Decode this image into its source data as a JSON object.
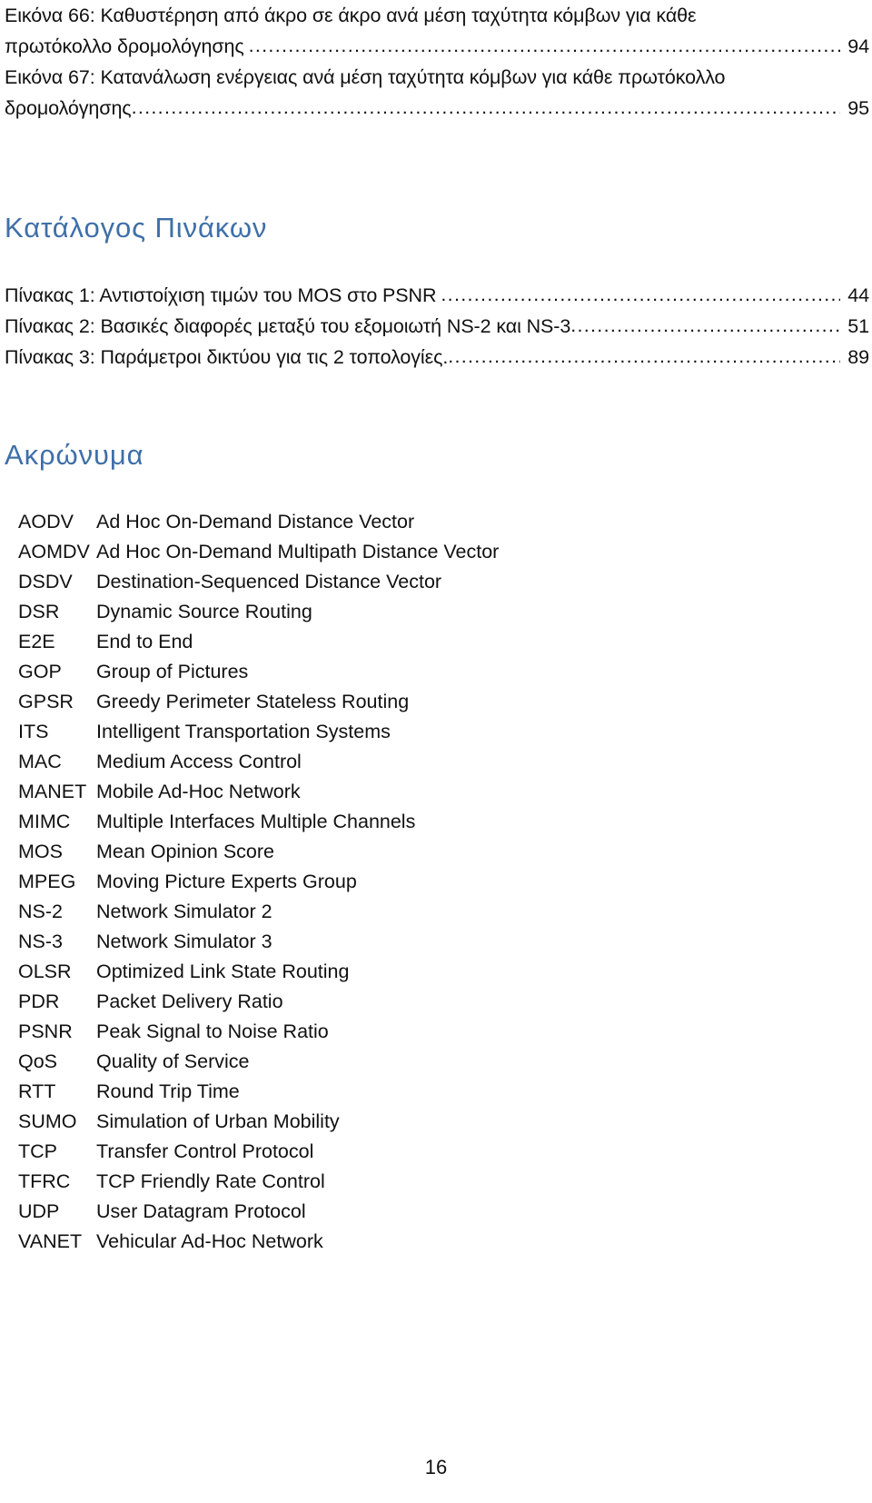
{
  "document": {
    "page_number": "16"
  },
  "figures_toc": {
    "entries": [
      {
        "line1": "Εικόνα 66: Καθυστέρηση από άκρο σε άκρο ανά μέση ταχύτητα κόμβων για κάθε",
        "line2": "πρωτόκολλο δρομολόγησης",
        "page": "94"
      },
      {
        "line1": "Εικόνα 67: Κατανάλωση ενέργειας ανά μέση ταχύτητα κόμβων για κάθε πρωτόκολλο",
        "line2": "δρομολόγησης",
        "page": "95"
      }
    ]
  },
  "tables_toc": {
    "heading": "Κατάλογος Πινάκων",
    "entries": [
      {
        "text": "Πίνακας 1: Αντιστοίχιση τιμών του MOS στο PSNR",
        "page": "44"
      },
      {
        "text": "Πίνακας 2: Βασικές διαφορές μεταξύ του εξομοιωτή NS-2 και NS-3",
        "page": "51"
      },
      {
        "text": "Πίνακας 3: Παράμετροι δικτύου για τις 2 τοπολογίες.",
        "page": "89"
      }
    ]
  },
  "acronyms": {
    "heading": "Ακρώνυμα",
    "items": [
      {
        "abbr": "AODV",
        "meaning": "Ad Hoc On-Demand Distance Vector"
      },
      {
        "abbr": "AOMDV",
        "meaning": "Ad Hoc On-Demand Multipath Distance Vector"
      },
      {
        "abbr": "DSDV",
        "meaning": "Destination-Sequenced Distance Vector"
      },
      {
        "abbr": "DSR",
        "meaning": "Dynamic Source Routing"
      },
      {
        "abbr": "E2E",
        "meaning": "End to End"
      },
      {
        "abbr": "GOP",
        "meaning": "Group of Pictures"
      },
      {
        "abbr": "GPSR",
        "meaning": "Greedy Perimeter Stateless Routing"
      },
      {
        "abbr": "ITS",
        "meaning": "Intelligent Transportation Systems"
      },
      {
        "abbr": "MAC",
        "meaning": "Medium Access Control"
      },
      {
        "abbr": "MANET",
        "meaning": "Mobile Ad-Hoc Network"
      },
      {
        "abbr": "MIMC",
        "meaning": "Multiple Interfaces Multiple Channels"
      },
      {
        "abbr": "MOS",
        "meaning": "Mean Opinion Score"
      },
      {
        "abbr": "MPEG",
        "meaning": "Moving Picture Experts Group"
      },
      {
        "abbr": "NS-2",
        "meaning": "Network Simulator 2"
      },
      {
        "abbr": "NS-3",
        "meaning": "Network Simulator 3"
      },
      {
        "abbr": "OLSR",
        "meaning": "Optimized Link State Routing"
      },
      {
        "abbr": "PDR",
        "meaning": "Packet Delivery Ratio"
      },
      {
        "abbr": "PSNR",
        "meaning": "Peak Signal to Noise Ratio"
      },
      {
        "abbr": "QoS",
        "meaning": "Quality of Service"
      },
      {
        "abbr": "RTT",
        "meaning": "Round Trip Time"
      },
      {
        "abbr": "SUMO",
        "meaning": "Simulation of Urban Mobility"
      },
      {
        "abbr": "TCP",
        "meaning": "Transfer Control Protocol"
      },
      {
        "abbr": "TFRC",
        "meaning": "TCP Friendly Rate Control"
      },
      {
        "abbr": "UDP",
        "meaning": "User Datagram Protocol"
      },
      {
        "abbr": "VANET",
        "meaning": "Vehicular Ad-Hoc Network"
      }
    ]
  },
  "colors": {
    "heading_blue": "#3f6fa8",
    "body_text": "#111111",
    "page_background": "#ffffff"
  }
}
